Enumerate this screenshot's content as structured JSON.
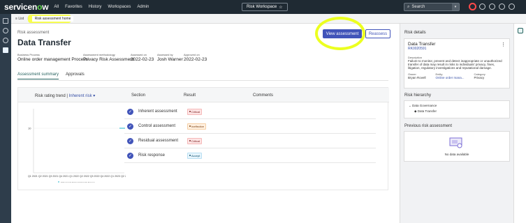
{
  "header": {
    "logo": "servicenow",
    "nav": [
      "All",
      "Favorites",
      "History",
      "Workspaces",
      "Admin"
    ],
    "workspace_title": "Risk Workspace",
    "search_label": "Search"
  },
  "tabbar": {
    "list_label": "List",
    "active_tab": "Risk assessment home"
  },
  "page": {
    "breadcrumb": "Risk assessment",
    "title": "Data Transfer",
    "view_button": "View assessment",
    "reassess_button": "Reassess"
  },
  "meta": [
    {
      "label": "Business Process",
      "value": "Online order management Process"
    },
    {
      "label": "Assessment methodology",
      "value": "Privacy Risk Assessment"
    },
    {
      "label": "Assessed on",
      "value": "2022-02-23"
    },
    {
      "label": "Assessed by",
      "value": "Josh Warner"
    },
    {
      "label": "Approved on",
      "value": "2022-02-23"
    }
  ],
  "tabs": [
    "Assessment summary",
    "Approvals"
  ],
  "chart_header": {
    "title": "Risk rating trend",
    "selected": "Inherent risk",
    "col_section": "Section",
    "col_result": "Result",
    "col_comments": "Comments"
  },
  "chart_data": {
    "type": "line",
    "x": [
      "Q1 2021",
      "Q2 2021",
      "Q3 2021",
      "Q4 2021",
      "Q1 2022",
      "Q2 2022",
      "Q3 2022",
      "Q4 2022",
      "Q1 2023",
      "Q2 2023",
      "Q3 2023",
      "Q4 2023",
      "Q1 2024"
    ],
    "x_tick_text": "Q1 2021 Q2 2021 Q3 2021 Q4 2021 Q1 2022 Q2 2022 Q3 2022 Q4 2022 Q1 2023 Q2 2023 Q3 2023 Q4 2023 Q1 2024",
    "series": [
      {
        "name": "Inherent Assessment Score",
        "values": [
          null,
          null,
          null,
          null,
          null,
          null,
          null,
          null,
          null,
          null,
          null,
          null,
          10
        ],
        "color": "#1fb3c9"
      }
    ],
    "y_tick": "10",
    "legend": "Inherent Assessment Score"
  },
  "sections": [
    {
      "label": "Inherent assessment",
      "result": "Critical",
      "type": "critical"
    },
    {
      "label": "Control assessment",
      "result": "Ineffective",
      "type": "ineffective"
    },
    {
      "label": "Residual assessment",
      "result": "Critical",
      "type": "critical"
    },
    {
      "label": "Risk response",
      "result": "Accept",
      "type": "accept"
    }
  ],
  "right": {
    "details_title": "Risk details",
    "card_title": "Data Transfer",
    "card_number": "RK0020591",
    "desc_label": "Description",
    "desc_text": "Failure to monitor, prevent and detect inappropriate or unauthorized transfer of data may result in risks to individuals' privacy, fines, litigation, regulatory investigations and reputational damage.",
    "owner_label": "Owner",
    "owner": "Bryan Rovell",
    "entity_label": "Entity",
    "entity": "Online order mana...",
    "category_label": "Category",
    "category": "Privacy",
    "hierarchy_title": "Risk hierarchy",
    "hierarchy_root": "Data Governance",
    "hierarchy_child": "Data Transfer",
    "prev_title": "Previous risk assessment",
    "no_data": "No data available"
  },
  "colors": {
    "accent": "#4154b9",
    "teal": "#26625f",
    "highlight": "#f8ff3c"
  }
}
